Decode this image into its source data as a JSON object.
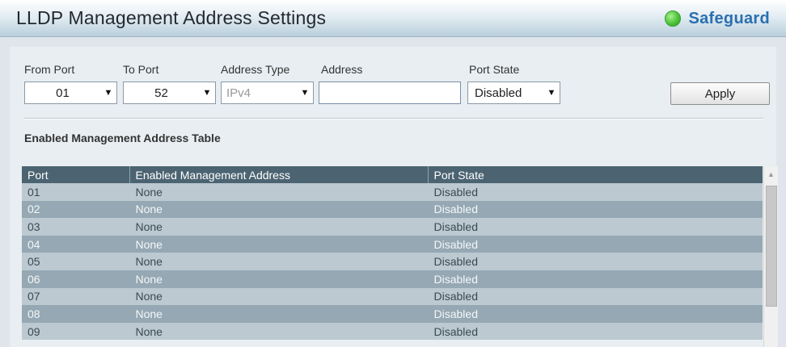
{
  "header": {
    "title": "LLDP Management Address Settings",
    "safeguard_label": "Safeguard",
    "safeguard_color": "#4cc33a"
  },
  "form": {
    "from_port_label": "From Port",
    "to_port_label": "To Port",
    "address_type_label": "Address Type",
    "address_label": "Address",
    "port_state_label": "Port State",
    "from_port_value": "01",
    "to_port_value": "52",
    "address_type_value": "IPv4",
    "address_value": "",
    "port_state_value": "Disabled",
    "apply_label": "Apply"
  },
  "table": {
    "section_title": "Enabled Management Address Table",
    "headers": [
      "Port",
      "Enabled Management Address",
      "Port State"
    ],
    "rows": [
      [
        "01",
        "None",
        "Disabled"
      ],
      [
        "02",
        "None",
        "Disabled"
      ],
      [
        "03",
        "None",
        "Disabled"
      ],
      [
        "04",
        "None",
        "Disabled"
      ],
      [
        "05",
        "None",
        "Disabled"
      ],
      [
        "06",
        "None",
        "Disabled"
      ],
      [
        "07",
        "None",
        "Disabled"
      ],
      [
        "08",
        "None",
        "Disabled"
      ],
      [
        "09",
        "None",
        "Disabled"
      ]
    ]
  },
  "icons": {
    "dropdown_arrow": "▼",
    "scroll_up": "▲"
  }
}
